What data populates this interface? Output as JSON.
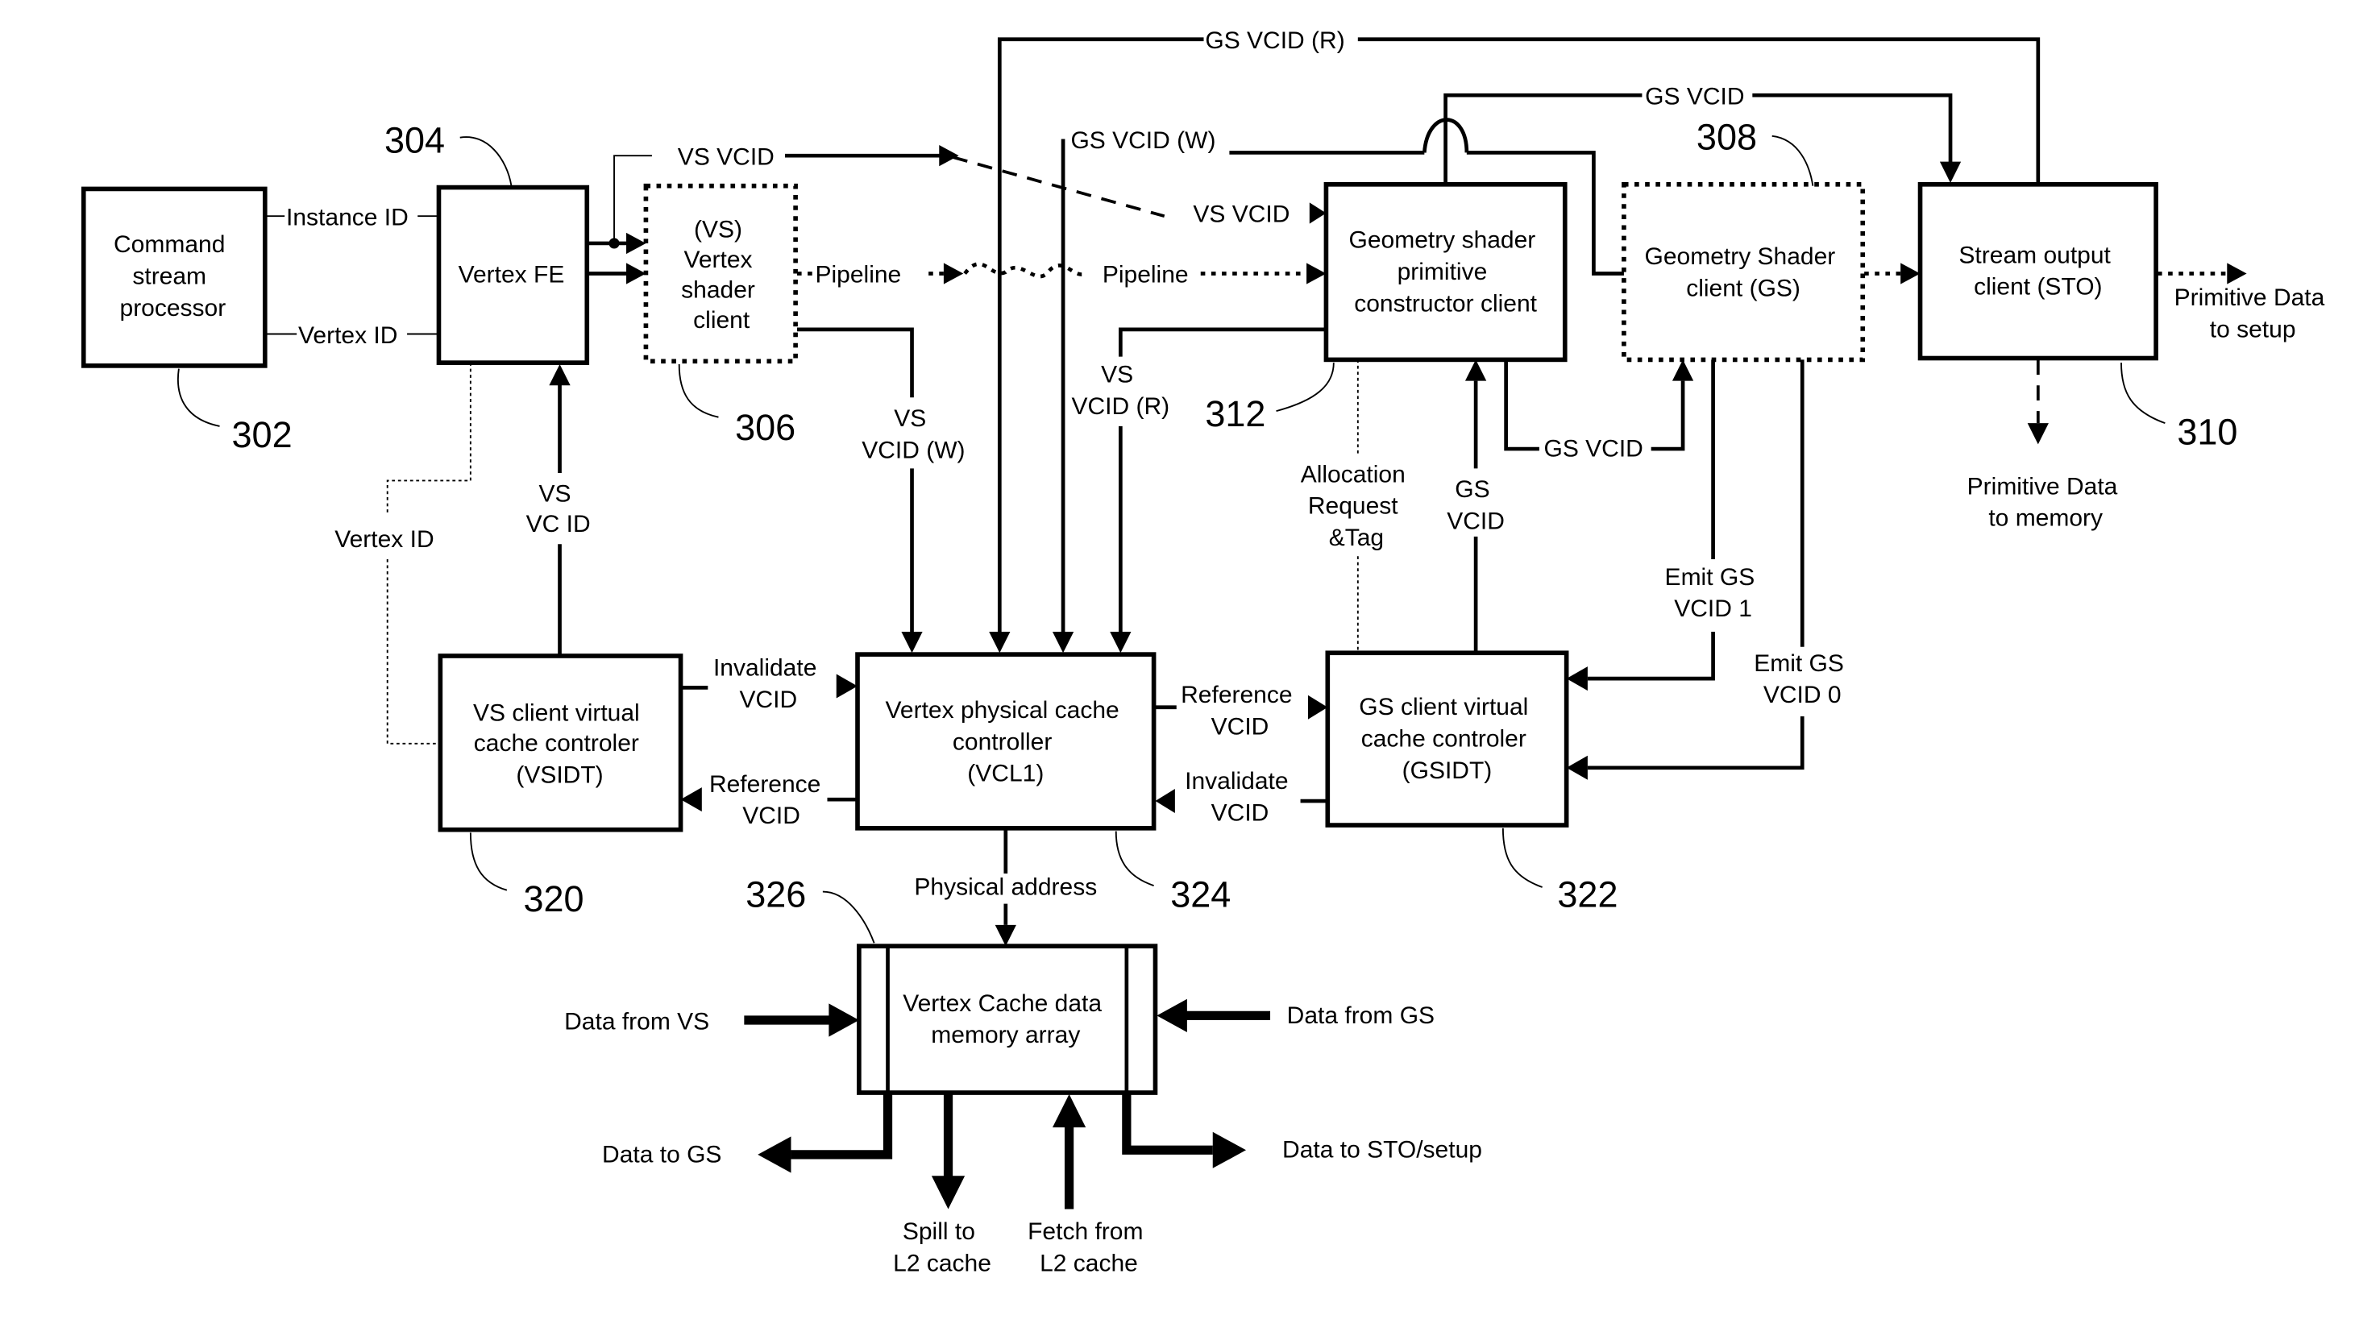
{
  "diagram": {
    "blocks": {
      "command_stream_processor": [
        "Command",
        "stream",
        "processor"
      ],
      "vertex_fe": [
        "Vertex FE"
      ],
      "vertex_shader_client": [
        "(VS)",
        "Vertex",
        "shader",
        "client"
      ],
      "gs_primitive_constructor": [
        "Geometry shader",
        "primitive",
        "constructor client"
      ],
      "geometry_shader_client": [
        "Geometry Shader",
        "client (GS)"
      ],
      "stream_output_client": [
        "Stream output",
        "client (STO)"
      ],
      "vs_client_virtual_cache": [
        "VS client virtual",
        "cache controler",
        "(VSIDT)"
      ],
      "vertex_physical_cache": [
        "Vertex physical cache",
        "controller",
        "(VCL1)"
      ],
      "gs_client_virtual_cache": [
        "GS client virtual",
        "cache controler",
        "(GSIDT)"
      ],
      "vertex_cache_data_memory": [
        "Vertex Cache data",
        "memory array"
      ]
    },
    "ref_numbers": {
      "r302": "302",
      "r304": "304",
      "r306": "306",
      "r308": "308",
      "r310": "310",
      "r312": "312",
      "r320": "320",
      "r322": "322",
      "r324": "324",
      "r326": "326"
    },
    "signals": {
      "instance_id": "Instance ID",
      "vertex_id_top": "Vertex ID",
      "vertex_id_left": "Vertex ID",
      "vs_vcid_top": "VS VCID",
      "vs_vcid_gs": "VS VCID",
      "pipeline_1": "Pipeline",
      "pipeline_2": "Pipeline",
      "gs_vcid_r": "GS VCID (R)",
      "gs_vcid_w": "GS VCID (W)",
      "gs_vcid_top": "GS VCID",
      "gs_vcid_bottom": "GS VCID",
      "vs_vcid_w": [
        "VS",
        "VCID (W)"
      ],
      "vs_vcid_r": [
        "VS",
        "VCID (R)"
      ],
      "vs_vc_id": [
        "VS",
        "VC ID"
      ],
      "allocation_request": [
        "Allocation",
        "Request",
        "&Tag"
      ],
      "gs_vcid_up": [
        "GS",
        "VCID"
      ],
      "emit_gs_vcid_1": [
        "Emit GS",
        "VCID 1"
      ],
      "emit_gs_vcid_0": [
        "Emit GS",
        "VCID 0"
      ],
      "invalidate_vcid_left": [
        "Invalidate",
        "VCID"
      ],
      "reference_vcid_left": [
        "Reference",
        "VCID"
      ],
      "reference_vcid_right": [
        "Reference",
        "VCID"
      ],
      "invalidate_vcid_right": [
        "Invalidate",
        "VCID"
      ],
      "physical_address": "Physical address",
      "primitive_data_setup": [
        "Primitive Data",
        "to setup"
      ],
      "primitive_data_memory": [
        "Primitive Data",
        "to memory"
      ],
      "data_from_vs": "Data from VS",
      "data_from_gs": "Data from GS",
      "data_to_gs": "Data to GS",
      "data_to_sto": "Data to STO/setup",
      "spill_l2": [
        "Spill to",
        "L2 cache"
      ],
      "fetch_l2": [
        "Fetch from",
        "L2 cache"
      ]
    }
  }
}
